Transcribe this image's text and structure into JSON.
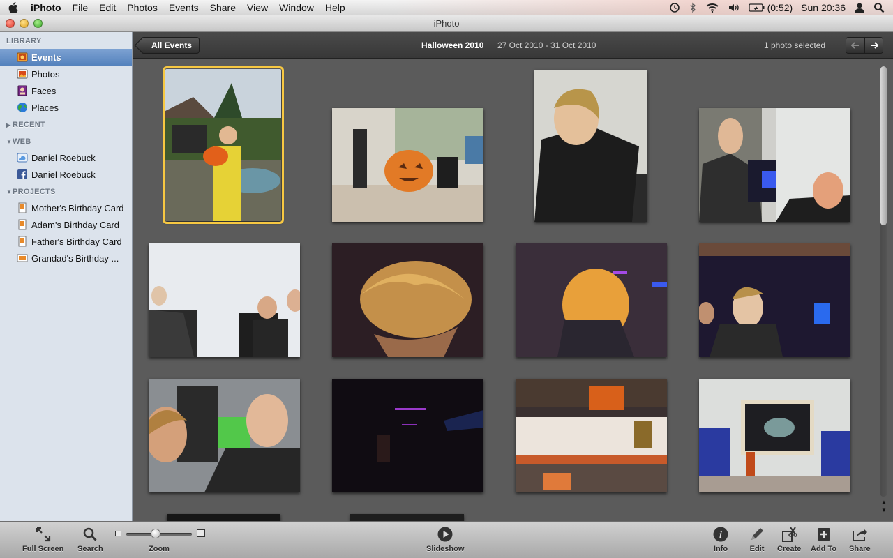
{
  "menubar": {
    "apple_icon": "apple-logo-icon",
    "app_name": "iPhoto",
    "items": [
      "File",
      "Edit",
      "Photos",
      "Events",
      "Share",
      "View",
      "Window",
      "Help"
    ],
    "status": {
      "battery": "(0:52)",
      "clock": "Sun 20:36"
    }
  },
  "window": {
    "title": "iPhoto"
  },
  "sidebar": {
    "sections": {
      "library": "LIBRARY",
      "recent": "RECENT",
      "web": "WEB",
      "projects": "PROJECTS"
    },
    "library_items": [
      {
        "label": "Events",
        "icon": "events-icon",
        "selected": true
      },
      {
        "label": "Photos",
        "icon": "photos-icon"
      },
      {
        "label": "Faces",
        "icon": "faces-icon"
      },
      {
        "label": "Places",
        "icon": "places-globe-icon"
      }
    ],
    "web_items": [
      {
        "label": "Daniel Roebuck",
        "icon": "mobileme-gallery-icon"
      },
      {
        "label": "Daniel Roebuck",
        "icon": "facebook-icon"
      }
    ],
    "project_items": [
      {
        "label": "Mother's Birthday Card",
        "icon": "card-project-icon"
      },
      {
        "label": "Adam's Birthday Card",
        "icon": "card-project-icon"
      },
      {
        "label": "Father's Birthday Card",
        "icon": "card-project-icon"
      },
      {
        "label": "Grandad's Birthday ...",
        "icon": "card-project-icon"
      }
    ]
  },
  "header": {
    "back_button": "All Events",
    "event_title": "Halloween 2010",
    "event_dates": "27 Oct 2010 - 31 Oct 2010",
    "selection_status": "1 photo selected"
  },
  "photos": {
    "count_visible": 14,
    "selected_index": 0
  },
  "toolbar": {
    "full_screen": "Full Screen",
    "search": "Search",
    "zoom": "Zoom",
    "zoom_level": 0.45,
    "slideshow": "Slideshow",
    "info": "Info",
    "edit": "Edit",
    "create": "Create",
    "add_to": "Add To",
    "share": "Share"
  },
  "colors": {
    "selection_yellow": "#f7c842",
    "sidebar_bg": "#dce3ec",
    "sidebar_selected": "#5482bd",
    "grid_bg": "#5b5b5b"
  }
}
